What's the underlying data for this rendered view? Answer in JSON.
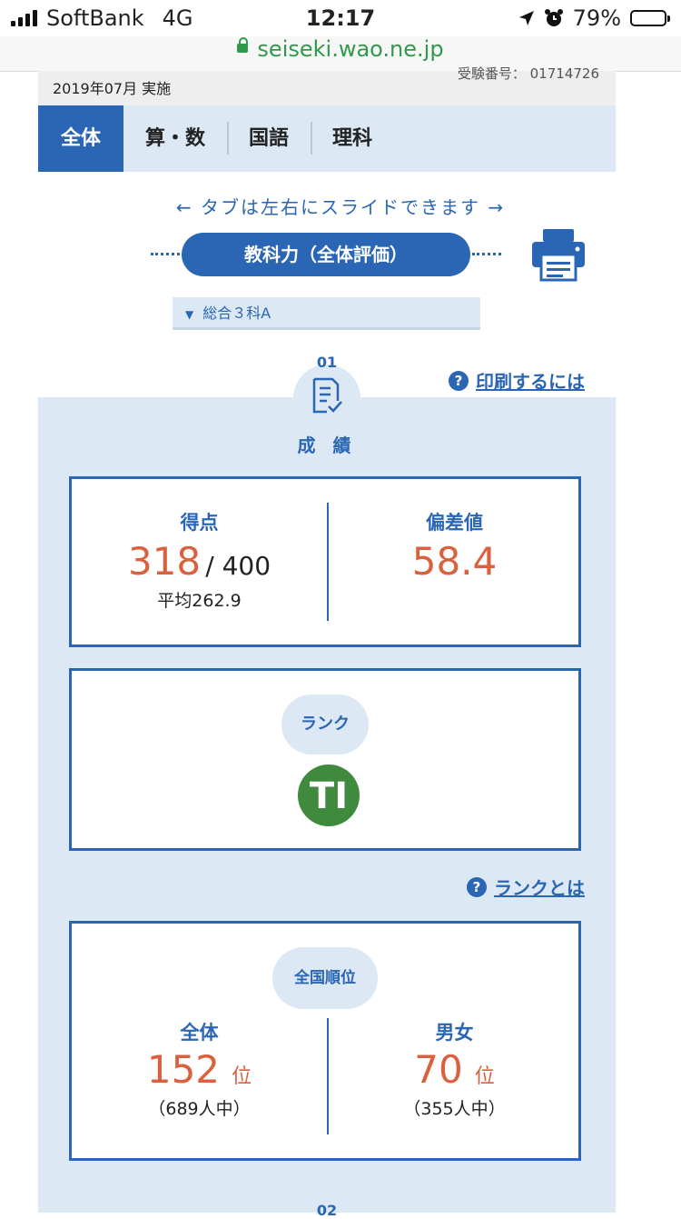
{
  "status_bar": {
    "carrier": "SoftBank",
    "network": "4G",
    "time": "12:17",
    "battery": "79%",
    "battery_level": 0.79
  },
  "browser": {
    "url": "seiseki.wao.ne.jp"
  },
  "info": {
    "date": "2019年07月 実施",
    "exam_number": "受験番号： 01714726"
  },
  "tabs": [
    {
      "label": "全体",
      "active": true
    },
    {
      "label": "算・数"
    },
    {
      "label": "国語"
    },
    {
      "label": "理科"
    }
  ],
  "slide_hint": "← タブは左右にスライドできます →",
  "view_pill": "教科力（全体評価）",
  "selector": {
    "value": "総合３科A"
  },
  "section": {
    "number": "01",
    "title": "成 績",
    "print_help": "印刷するには"
  },
  "score_card": {
    "score_label": "得点",
    "score": "318",
    "total": "/ 400",
    "average": "平均262.9",
    "deviation_label": "偏差値",
    "deviation": "58.4"
  },
  "rank_card": {
    "label": "ランク",
    "rank_symbol": "TI"
  },
  "rank_help": "ランクとは",
  "national_rank": {
    "label": "全国順位",
    "overall_label": "全体",
    "overall_rank": "152",
    "overall_unit": "位",
    "overall_total": "（689人中）",
    "gender_label": "男女",
    "gender_rank": "70",
    "gender_unit": "位",
    "gender_total": "（355人中）"
  },
  "next_section_number": "02",
  "colors": {
    "primary": "#2a66b4",
    "accent": "#d9613d",
    "panel": "#dce8f4",
    "rank_badge": "#3f8a3d"
  }
}
